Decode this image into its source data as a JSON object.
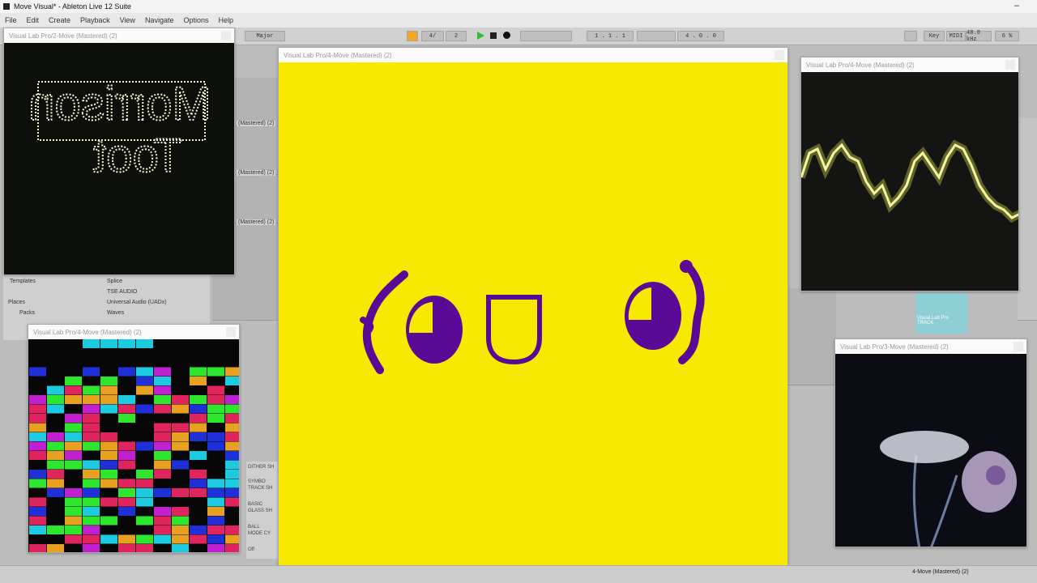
{
  "app": {
    "title": "Move Visual* - Ableton Live 12 Suite"
  },
  "menu": [
    "File",
    "Edit",
    "Create",
    "Playback",
    "View",
    "Navigate",
    "Options",
    "Help"
  ],
  "transport": {
    "scale": "Major",
    "signature": "4/",
    "sig_value": "2",
    "position": "1 . 1 . 1",
    "loop_end": "4 . 0 . 0",
    "key_label": "Key",
    "midi_label": "MIDI",
    "sample_rate": "48.0 kHz",
    "cpu": "6 %"
  },
  "clips": [
    "(Mastered) (2)",
    "(Mastered) (2)",
    "(Mastered) (2)"
  ],
  "browser": {
    "places_label": "Places",
    "templates": "Templates",
    "packs": "Packs",
    "items": [
      "Splice",
      "TSE AUDIO",
      "Universal Audio (UADx)",
      "Waves"
    ]
  },
  "side_panel": [
    "DITHER SH",
    "SYMBO",
    "TRACK SH",
    "BASIC",
    "GLASS SH",
    "BALL",
    "MODE CY",
    "Off"
  ],
  "windows": {
    "w1_title": "Visual Lab Pro/2-Move (Mastered) (2)",
    "w2_title": "Visual Lab Pro/4-Move (Mastered) (2)",
    "w3_title": "Visual Lab Pro/4-Move (Mastered) (2)",
    "w4_title": "Visual Lab Pro/4-Move (Mastered) (2)",
    "w5_title": "Visual Lab Pro/3-Move (Mastered) (2)"
  },
  "w1_text": {
    "line1": "Morrison",
    "line2": "Toot"
  },
  "mini_track": {
    "line1": "Visual Lab Pro",
    "line2": "TRACK"
  },
  "status": {
    "track": "4-Move (Mastered) (2)"
  },
  "colors": {
    "yellow": "#f7ea00",
    "purple": "#5a0a96",
    "neon": "#f2f25a",
    "dark": "#0d100a"
  }
}
